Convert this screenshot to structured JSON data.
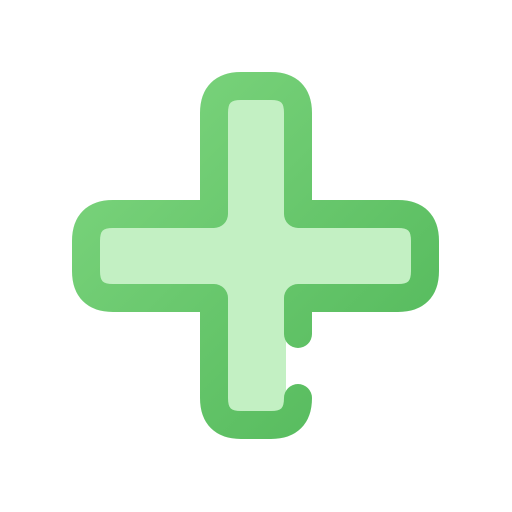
{
  "icon": {
    "name": "plus-icon",
    "colors": {
      "outline_start": "#7ed67f",
      "outline_end": "#52b85a",
      "fill": "#c3f0c3",
      "background": "#ffffff"
    }
  }
}
